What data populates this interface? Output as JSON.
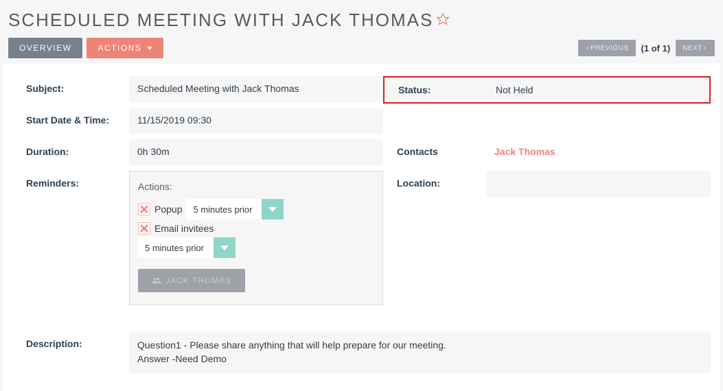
{
  "header": {
    "title": "Scheduled Meeting with Jack Thomas"
  },
  "toolbar": {
    "overview_label": "OVERVIEW",
    "actions_label": "ACTIONS"
  },
  "pager": {
    "previous_label": "PREVIOUS",
    "next_label": "NEXT",
    "position": "(1 of 1)"
  },
  "details": {
    "subject_label": "Subject:",
    "subject_value": "Scheduled Meeting with Jack Thomas",
    "start_label": "Start Date & Time:",
    "start_value": "11/15/2019 09:30",
    "duration_label": "Duration:",
    "duration_value": "0h 30m",
    "reminders_label": "Reminders:",
    "description_label": "Description:",
    "description_value": "Question1 - Please share anything that will help prepare for our meeting.\nAnswer -Need Demo"
  },
  "status": {
    "label": "Status:",
    "value": "Not Held"
  },
  "right": {
    "contacts_label": "Contacts",
    "contacts_value": "Jack Thomas",
    "location_label": "Location:",
    "location_value": ""
  },
  "reminders": {
    "actions_title": "Actions:",
    "popup_label": "Popup",
    "popup_time": "5 minutes prior",
    "email_label": "Email invitees",
    "email_time": "5 minutes prior",
    "invitee_button": "JACK THOMAS"
  }
}
